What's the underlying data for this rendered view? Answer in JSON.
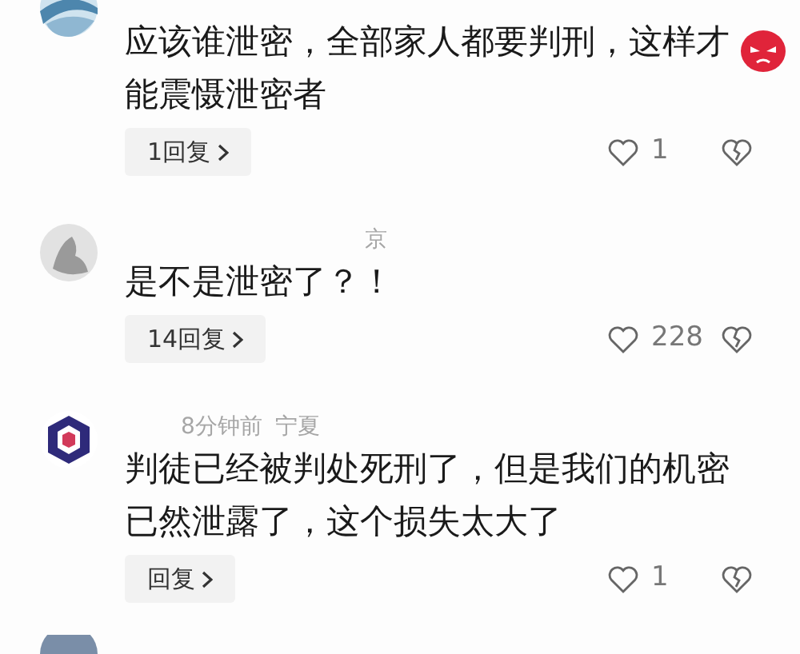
{
  "comments": [
    {
      "text": "应该谁泄密，全部家人都要判刑，这样才能震慑泄密者",
      "emoji": true,
      "replies": "1回复",
      "likes": "1"
    },
    {
      "meta": [
        "京"
      ],
      "text": "是不是泄密了？！",
      "emoji": false,
      "replies": "14回复",
      "likes": "228"
    },
    {
      "meta": [
        "8分钟前",
        "宁夏"
      ],
      "text": "判徒已经被判处死刑了，但是我们的机密已然泄露了，这个损失太大了",
      "emoji": false,
      "replies": "回复",
      "likes": "1"
    }
  ]
}
